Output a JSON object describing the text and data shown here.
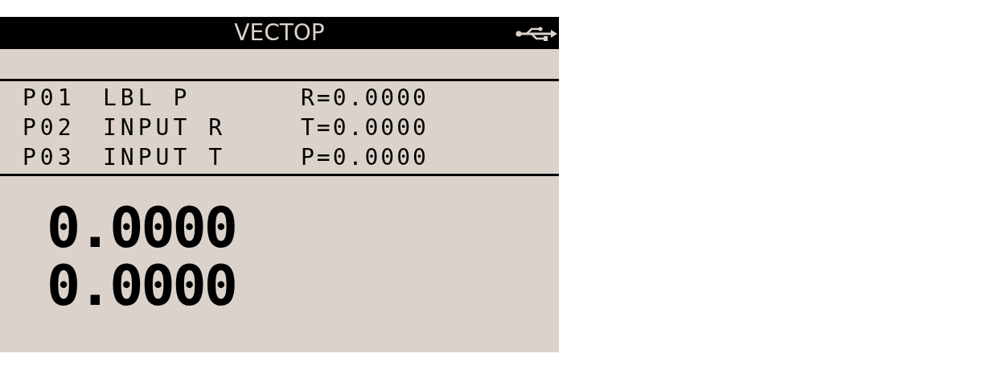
{
  "title_bar": {
    "title": "VECTOP"
  },
  "program_lines": [
    {
      "number": "P01",
      "command": "LBL P",
      "variable": "R=0.0000"
    },
    {
      "number": "P02",
      "command": "INPUT R",
      "variable": "T=0.0000"
    },
    {
      "number": "P03",
      "command": "INPUT T",
      "variable": "P=0.0000"
    }
  ],
  "stack_values": [
    "0.0000",
    "0.0000"
  ]
}
